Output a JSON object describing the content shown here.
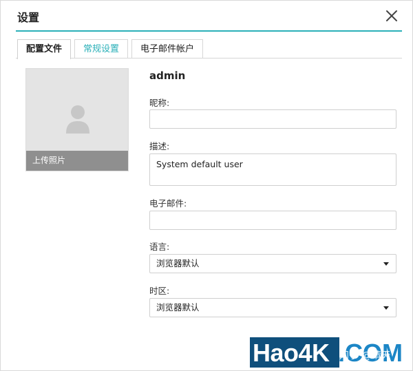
{
  "dialog": {
    "title": "设置",
    "close_icon": "close-icon"
  },
  "tabs": [
    {
      "label": "配置文件",
      "active": true
    },
    {
      "label": "常规设置",
      "active": false
    },
    {
      "label": "电子邮件帐户",
      "active": false
    }
  ],
  "profile": {
    "avatar_icon": "user-silhouette-icon",
    "upload_label": "上传照片",
    "username": "admin",
    "nickname": {
      "label": "昵称:",
      "value": ""
    },
    "description": {
      "label": "描述:",
      "value": "System default user"
    },
    "email": {
      "label": "电子邮件:",
      "value": ""
    },
    "language": {
      "label": "语言:",
      "value": "浏览器默认"
    },
    "timezone": {
      "label": "时区:",
      "value": "浏览器默认"
    }
  },
  "watermark": {
    "brand": "Hao4K",
    "suffix": ".COM",
    "overlay": "知乎 @晴天"
  },
  "colors": {
    "accent": "#2ab0b8",
    "upload_bar": "#8f8f8f",
    "photo_bg": "#e4e4e4"
  }
}
